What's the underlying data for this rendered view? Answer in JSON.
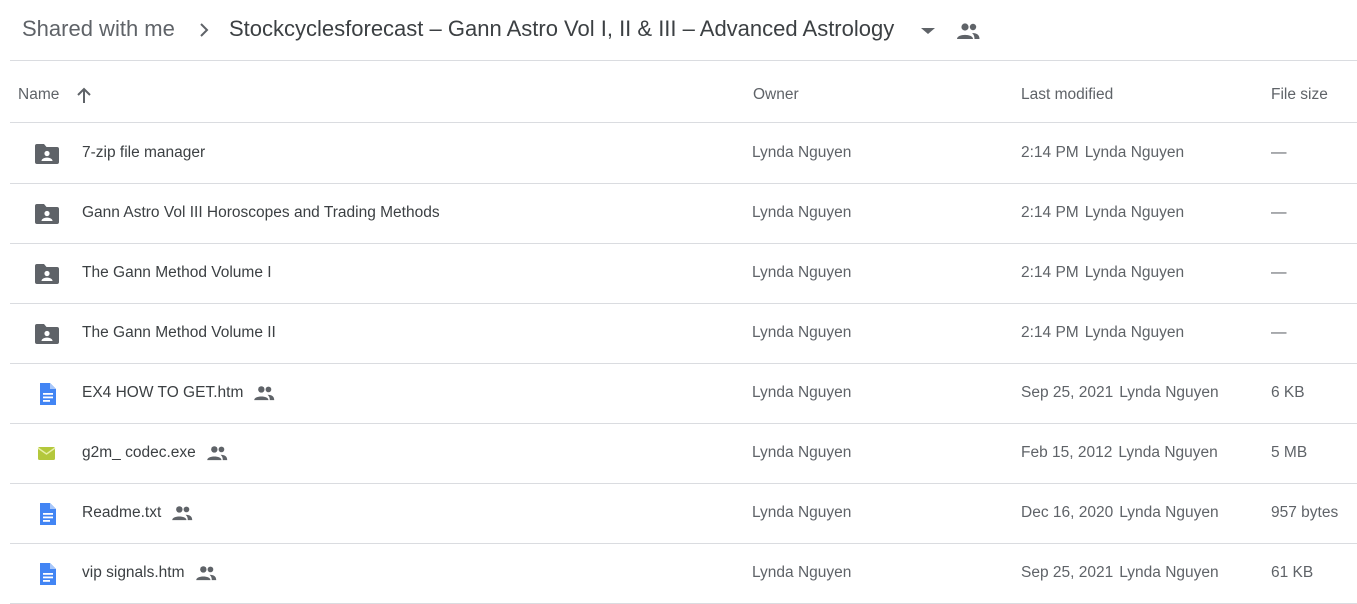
{
  "breadcrumb": {
    "root": "Shared with me",
    "current": "Stockcyclesforecast – Gann Astro Vol I, II & III – Advanced Astrology"
  },
  "columns": {
    "name": "Name",
    "owner": "Owner",
    "last_modified": "Last modified",
    "file_size": "File size"
  },
  "colors": {
    "folder": "#5f6368",
    "doc": "#4285f4",
    "exe": "#b4c83c",
    "divider": "#dadce0"
  },
  "files": [
    {
      "name": "7-zip file manager",
      "type": "shared-folder",
      "shared": false,
      "owner": "Lynda Nguyen",
      "modified_date": "2:14 PM",
      "modified_by": "Lynda Nguyen",
      "size": "—"
    },
    {
      "name": "Gann Astro Vol III Horoscopes and Trading Methods",
      "type": "shared-folder",
      "shared": false,
      "owner": "Lynda Nguyen",
      "modified_date": "2:14 PM",
      "modified_by": "Lynda Nguyen",
      "size": "—"
    },
    {
      "name": "The Gann Method Volume I",
      "type": "shared-folder",
      "shared": false,
      "owner": "Lynda Nguyen",
      "modified_date": "2:14 PM",
      "modified_by": "Lynda Nguyen",
      "size": "—"
    },
    {
      "name": "The Gann Method Volume II",
      "type": "shared-folder",
      "shared": false,
      "owner": "Lynda Nguyen",
      "modified_date": "2:14 PM",
      "modified_by": "Lynda Nguyen",
      "size": "—"
    },
    {
      "name": "EX4 HOW TO GET.htm",
      "type": "doc",
      "shared": true,
      "owner": "Lynda Nguyen",
      "modified_date": "Sep 25, 2021",
      "modified_by": "Lynda Nguyen",
      "size": "6 KB"
    },
    {
      "name": "g2m_ codec.exe",
      "type": "exe",
      "shared": true,
      "owner": "Lynda Nguyen",
      "modified_date": "Feb 15, 2012",
      "modified_by": "Lynda Nguyen",
      "size": "5 MB"
    },
    {
      "name": "Readme.txt",
      "type": "doc",
      "shared": true,
      "owner": "Lynda Nguyen",
      "modified_date": "Dec 16, 2020",
      "modified_by": "Lynda Nguyen",
      "size": "957 bytes"
    },
    {
      "name": "vip signals.htm",
      "type": "doc",
      "shared": true,
      "owner": "Lynda Nguyen",
      "modified_date": "Sep 25, 2021",
      "modified_by": "Lynda Nguyen",
      "size": "61 KB"
    }
  ]
}
